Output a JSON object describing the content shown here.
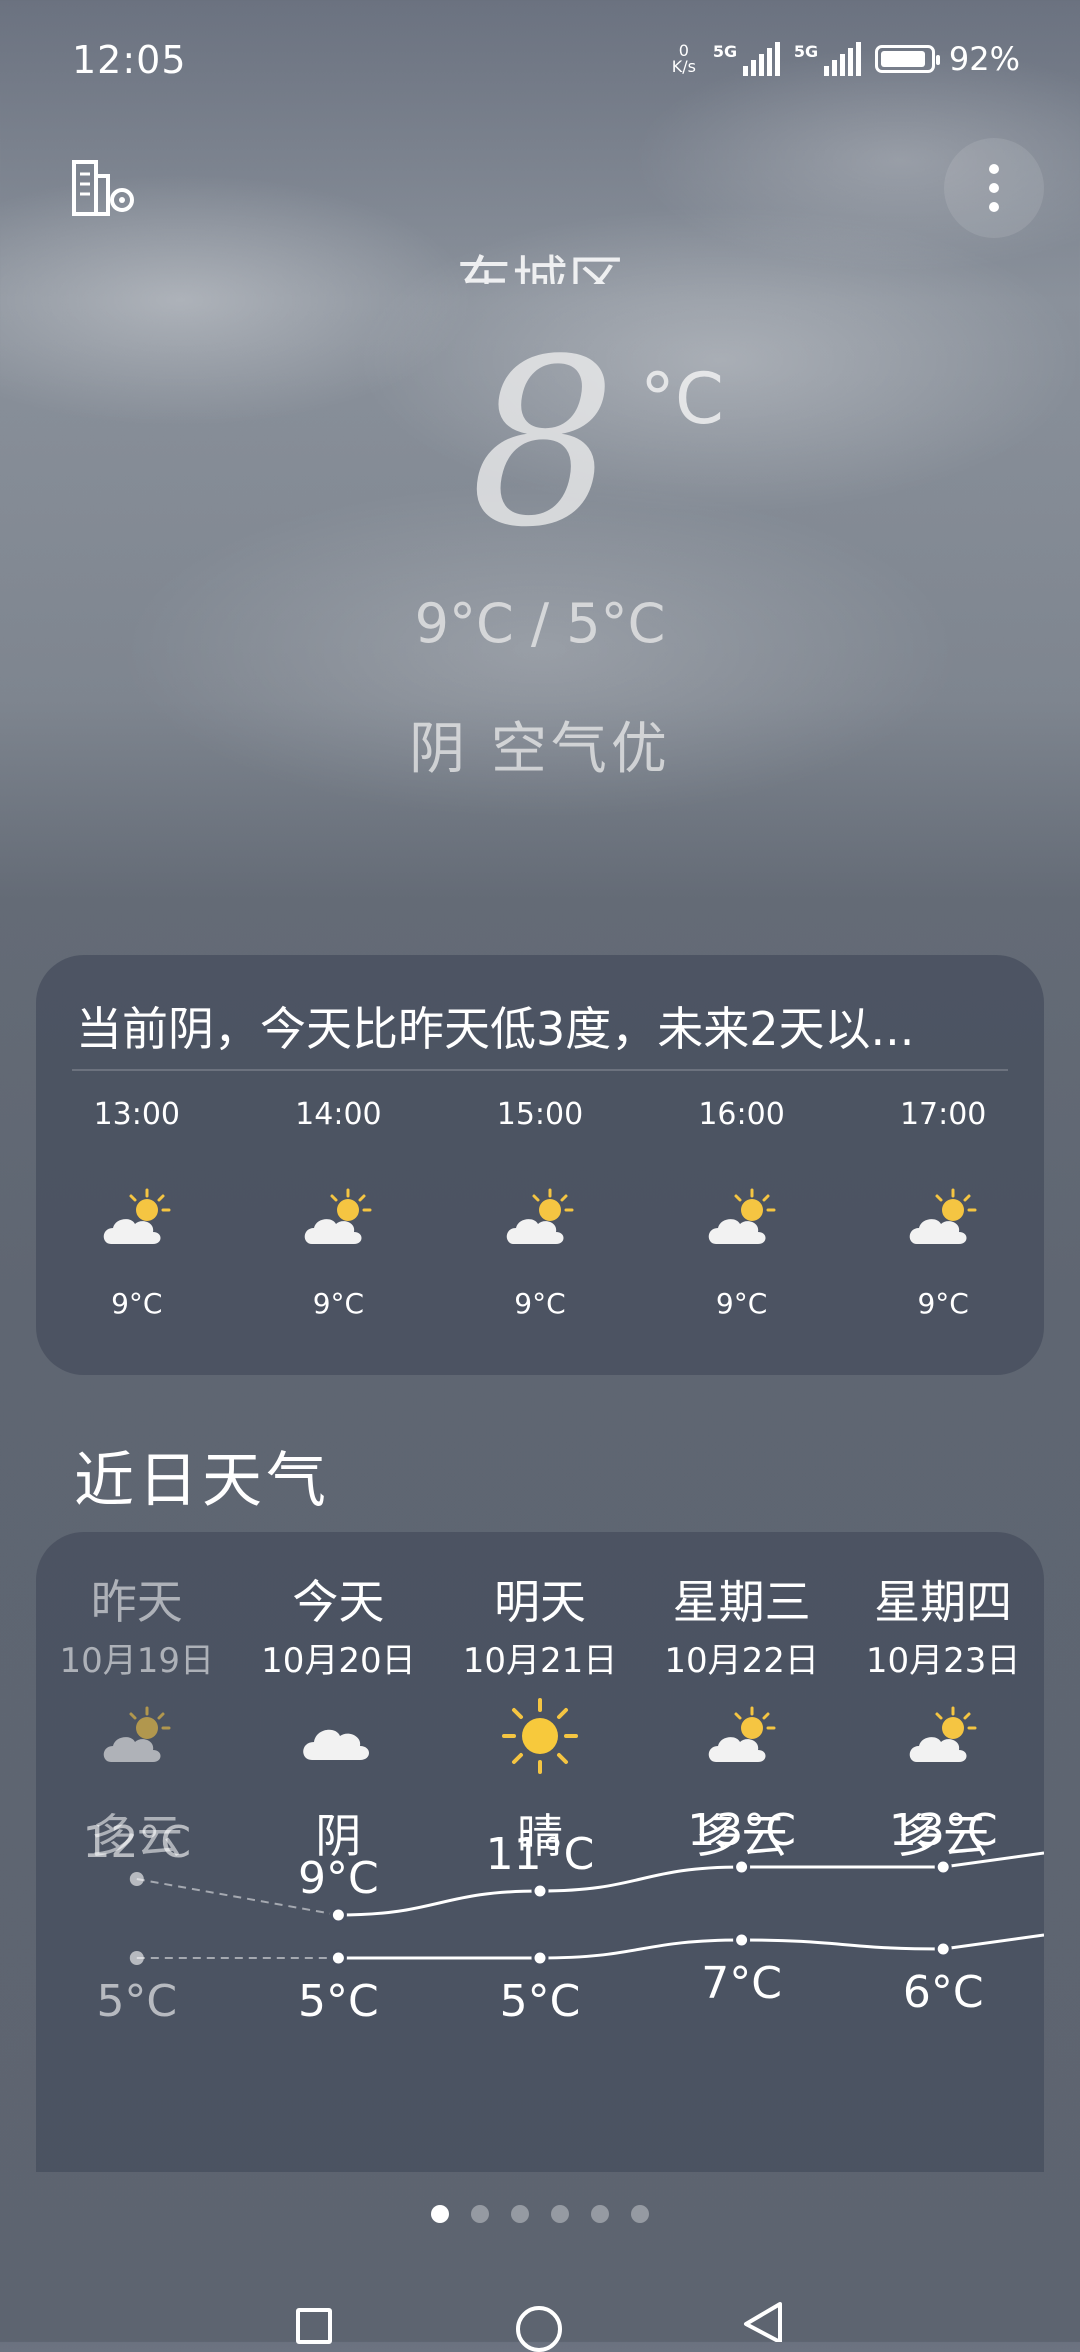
{
  "status_bar": {
    "time": "12:05",
    "net_speed_value": "0",
    "net_speed_unit": "K/s",
    "sim1": "5G",
    "sim2": "5G",
    "battery_text": "92%",
    "battery_level": 0.92
  },
  "current": {
    "city": "东城区",
    "temperature": "8",
    "unit": "°C",
    "range": "9°C / 5°C",
    "condition": "阴 空气优"
  },
  "summary_card": {
    "text": "当前阴，今天比昨天低3度，未来2天以..."
  },
  "hourly": [
    {
      "time": "13:00",
      "icon": "partly-cloudy-icon",
      "temp": "9°C"
    },
    {
      "time": "14:00",
      "icon": "partly-cloudy-icon",
      "temp": "9°C"
    },
    {
      "time": "15:00",
      "icon": "partly-cloudy-icon",
      "temp": "9°C"
    },
    {
      "time": "16:00",
      "icon": "partly-cloudy-icon",
      "temp": "9°C"
    },
    {
      "time": "17:00",
      "icon": "partly-cloudy-icon",
      "temp": "9°C"
    }
  ],
  "section_title": "近日天气",
  "daily": [
    {
      "name": "昨天",
      "date": "10月19日",
      "icon": "partly-cloudy-icon",
      "cond": "多云",
      "high": "12°C",
      "low": "5°C"
    },
    {
      "name": "今天",
      "date": "10月20日",
      "icon": "cloudy-icon",
      "cond": "阴",
      "high": "9°C",
      "low": "5°C"
    },
    {
      "name": "明天",
      "date": "10月21日",
      "icon": "sunny-icon",
      "cond": "晴",
      "high": "11°C",
      "low": "5°C"
    },
    {
      "name": "星期三",
      "date": "10月22日",
      "icon": "partly-cloudy-icon",
      "cond": "多云",
      "high": "13°C",
      "low": "7°C"
    },
    {
      "name": "星期四",
      "date": "10月23日",
      "icon": "partly-cloudy-icon",
      "cond": "多云",
      "high": "13°C",
      "low": "6°C"
    }
  ],
  "chart_data": {
    "type": "line",
    "categories": [
      "昨天",
      "今天",
      "明天",
      "星期三",
      "星期四"
    ],
    "series": [
      {
        "values": [
          12,
          9,
          11,
          13,
          13
        ]
      },
      {
        "values": [
          5,
          5,
          5,
          7,
          6
        ]
      }
    ]
  },
  "pager": {
    "count": 6,
    "active": 0
  }
}
